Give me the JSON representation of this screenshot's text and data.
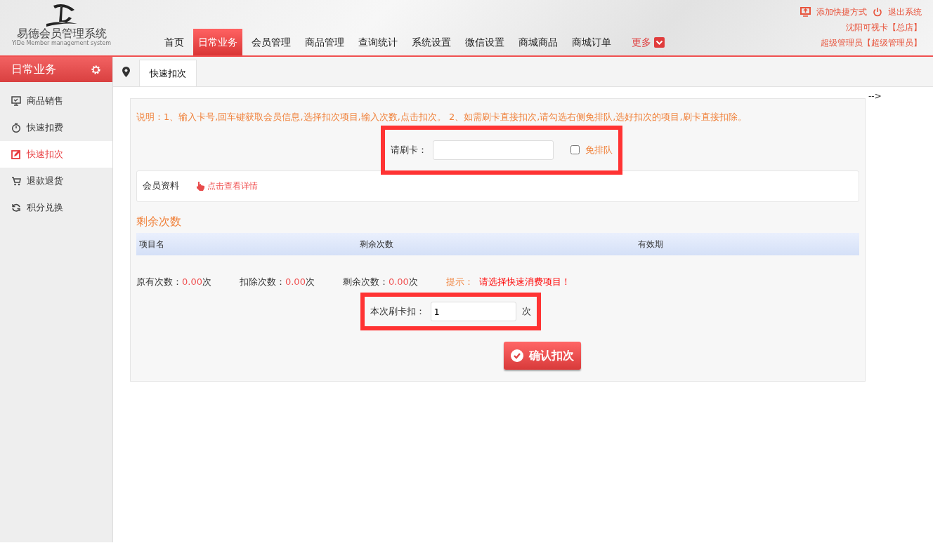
{
  "logo": {
    "title": "易德会员管理系统",
    "subtitle": "YiDe Member management system"
  },
  "nav": [
    {
      "label": "首页",
      "selected": false
    },
    {
      "label": "日常业务",
      "selected": true
    },
    {
      "label": "会员管理",
      "selected": false
    },
    {
      "label": "商品管理",
      "selected": false
    },
    {
      "label": "查询统计",
      "selected": false
    },
    {
      "label": "系统设置",
      "selected": false
    },
    {
      "label": "微信设置",
      "selected": false
    },
    {
      "label": "商城商品",
      "selected": false
    },
    {
      "label": "商城订单",
      "selected": false
    }
  ],
  "more": "更多",
  "top_links": [
    "添加快捷方式",
    "退出系统"
  ],
  "store": "沈阳可视卡【总店】",
  "user": "超级管理员【超级管理员】",
  "sidebar": {
    "title": "日常业务",
    "items": [
      {
        "label": "商品销售",
        "selected": false
      },
      {
        "label": "快速扣费",
        "selected": false
      },
      {
        "label": "快速扣次",
        "selected": true
      },
      {
        "label": "退款退货",
        "selected": false
      },
      {
        "label": "积分兑换",
        "selected": false
      }
    ]
  },
  "tabs": [
    {
      "label": "快速扣次",
      "selected": true
    }
  ],
  "stray_text": "-->",
  "instructions": "说明：1、输入卡号,回车键获取会员信息,选择扣次项目,输入次数,点击扣次。 2、如需刷卡直接扣次,请勾选右侧免排队,选好扣次的项目,刷卡直接扣除。",
  "card_field": {
    "label": "请刷卡："
  },
  "skip_queue": {
    "label": "免排队",
    "checked": false
  },
  "member": {
    "label": "会员资料",
    "link": "点击查看详情"
  },
  "section_title": "剩余次数",
  "table": {
    "columns": [
      "项目名",
      "剩余次数",
      "有效期"
    ]
  },
  "stats": [
    {
      "label": "原有次数：",
      "value": "0.00",
      "unit": "次"
    },
    {
      "label": "扣除次数：",
      "value": "0.00",
      "unit": "次"
    },
    {
      "label": "剩余次数：",
      "value": "0.00",
      "unit": "次"
    }
  ],
  "hint": {
    "label": "提示：",
    "text": "请选择快速消费项目！"
  },
  "deduct": {
    "label": "本次刷卡扣：",
    "value": "1",
    "unit": "次"
  },
  "confirm_button": "确认扣次"
}
